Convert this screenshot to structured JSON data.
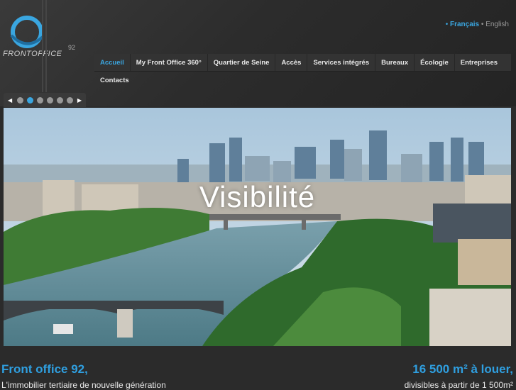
{
  "brand": {
    "name": "FRONTOFFICE",
    "number": "92"
  },
  "languages": {
    "active": "Français",
    "other": "English"
  },
  "nav": {
    "items": [
      "Accueil",
      "My Front Office 360°",
      "Quartier de Seine",
      "Accès",
      "Services intégrés",
      "Bureaux",
      "Écologie",
      "Entreprises"
    ],
    "second_row": [
      "Contacts"
    ],
    "active_index": 0
  },
  "slider": {
    "total": 6,
    "active": 1
  },
  "hero": {
    "caption": "Visibilité"
  },
  "footer": {
    "left_title": "Front office 92,",
    "left_sub": "L'immobilier tertiaire de nouvelle génération",
    "right_title": "16 500 m² à louer,",
    "right_sub": "divisibles à partir de 1 500m²"
  },
  "colors": {
    "accent": "#3aa6e0",
    "background": "#2b2b2b"
  }
}
